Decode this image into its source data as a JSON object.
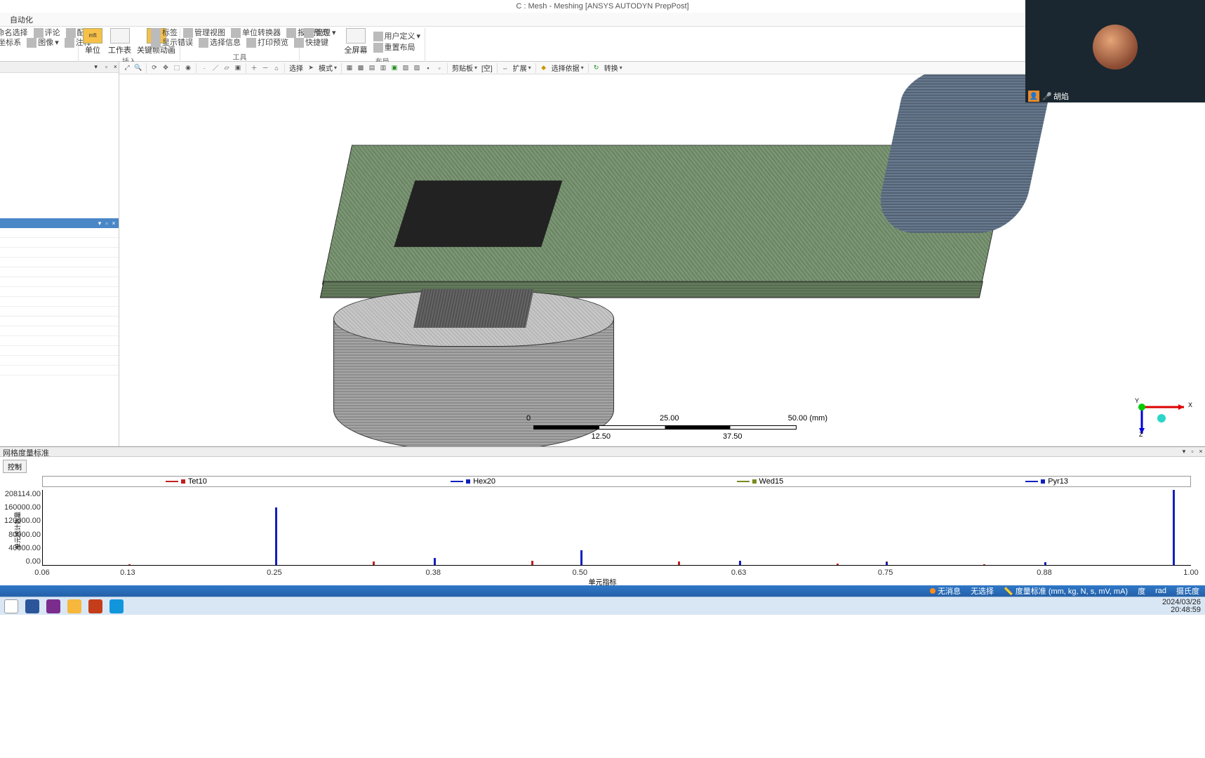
{
  "title": "C : Mesh - Meshing [ANSYS AUTODYN PrepPost]",
  "tabs": {
    "automation": "自动化"
  },
  "ribbon": {
    "g1": {
      "r1a": "命名选择",
      "r1b": "评论",
      "r1c": "配率",
      "r2a": "坐标系",
      "r2b": "图像",
      "r2c": "注释",
      "big_unit": "单位",
      "big_ws": "工作表",
      "big_kf": "关键帧动画",
      "label": "插入"
    },
    "g2": {
      "a": "标签",
      "b": "管理视图",
      "c": "单位转换器",
      "d": "报告预览",
      "e": "显示错误",
      "f": "选择信息",
      "g": "打印预览",
      "h": "快捷键",
      "i": "管理",
      "label": "工具"
    },
    "g3": {
      "a": "全屏幕",
      "b": "用户定义",
      "c": "重置布局",
      "label": "布局"
    }
  },
  "vtoolbar": {
    "select": "选择",
    "mode": "模式",
    "clipboard": "剪贴板",
    "empty": "[空]",
    "extend": "扩展",
    "select_by": "选择依据",
    "convert": "转换"
  },
  "scale": {
    "t0": "0",
    "t12": "12.50",
    "t25": "25.00",
    "t37": "37.50",
    "t50": "50.00 (mm)"
  },
  "triad": {
    "x": "X",
    "y": "Y",
    "z": "Z"
  },
  "metrics": {
    "header": "网格度量标准",
    "control": "控制",
    "legend": {
      "s1": "Tet10",
      "s2": "Hex20",
      "s3": "Wed15",
      "s4": "Pyr13"
    },
    "yticks": [
      "208114.00",
      "160000.00",
      "120000.00",
      "80000.00",
      "40000.00",
      "0.00"
    ],
    "ylabel": "单元统计数量",
    "xticks": [
      "0.06",
      "0.13",
      "0.25",
      "0.38",
      "0.50",
      "0.63",
      "0.75",
      "0.88",
      "1.00"
    ],
    "xlabel": "单元指标"
  },
  "status": {
    "msg": "无消息",
    "sel": "无选择",
    "metric": "度量标准 (mm, kg, N, s, mV, mA)",
    "deg": "度",
    "rad": "rad",
    "temp": "摄氏度"
  },
  "clock": {
    "date": "2024/03/26",
    "time": "20:48:59"
  },
  "overlay": {
    "name": "胡焰"
  },
  "chart_data": {
    "type": "bar",
    "xlabel": "单元指标",
    "ylabel": "单元统计数量",
    "ylim": [
      0,
      208114
    ],
    "xrange": [
      0.06,
      1.0
    ],
    "series": [
      {
        "name": "Tet10",
        "color": "#c02020",
        "points": [
          {
            "x": 0.13,
            "y": 2000
          },
          {
            "x": 0.25,
            "y": 3000
          },
          {
            "x": 0.33,
            "y": 10000
          },
          {
            "x": 0.38,
            "y": 4000
          },
          {
            "x": 0.46,
            "y": 12000
          },
          {
            "x": 0.5,
            "y": 5000
          },
          {
            "x": 0.58,
            "y": 9000
          },
          {
            "x": 0.63,
            "y": 3000
          },
          {
            "x": 0.71,
            "y": 3000
          },
          {
            "x": 0.75,
            "y": 10000
          },
          {
            "x": 0.83,
            "y": 2000
          },
          {
            "x": 0.88,
            "y": 4000
          }
        ]
      },
      {
        "name": "Hex20",
        "color": "#1020c0",
        "points": [
          {
            "x": 0.25,
            "y": 160000
          },
          {
            "x": 0.38,
            "y": 20000
          },
          {
            "x": 0.5,
            "y": 40000
          },
          {
            "x": 0.63,
            "y": 12000
          },
          {
            "x": 0.75,
            "y": 8000
          },
          {
            "x": 0.88,
            "y": 8000
          },
          {
            "x": 0.985,
            "y": 208114
          }
        ]
      },
      {
        "name": "Wed15",
        "color": "#7a8a20",
        "points": []
      },
      {
        "name": "Pyr13",
        "color": "#1020c0",
        "points": []
      }
    ]
  }
}
